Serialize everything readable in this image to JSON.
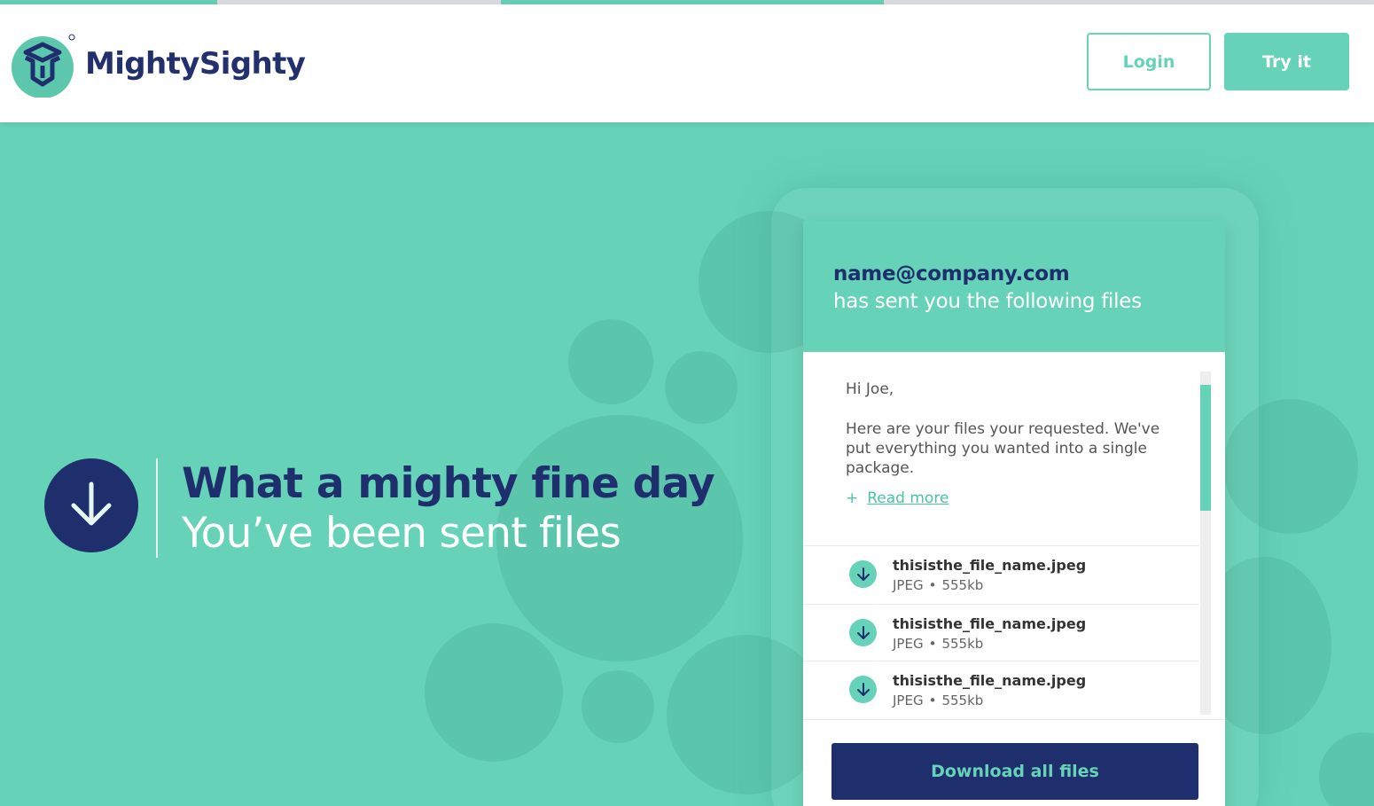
{
  "header": {
    "brand": "MightySighty",
    "login_label": "Login",
    "try_label": "Try it"
  },
  "hero": {
    "title": "What a mighty fine day",
    "subtitle": "You’ve been sent files"
  },
  "card": {
    "sender_email": "name@company.com",
    "sender_text": "has sent you the following files",
    "greeting": "Hi Joe,",
    "message": "Here are your files your requested. We've put everything you wanted into a single package.",
    "read_more_plus": "+",
    "read_more": "Read more",
    "files": [
      {
        "name": "thisisthe_file_name.jpeg",
        "type": "JPEG",
        "size": "555kb"
      },
      {
        "name": "thisisthe_file_name.jpeg",
        "type": "JPEG",
        "size": "555kb"
      },
      {
        "name": "thisisthe_file_name.jpeg",
        "type": "JPEG",
        "size": "555kb"
      }
    ],
    "download_all_label": "Download all files",
    "meta_separator": "•"
  },
  "colors": {
    "accent": "#66d2b8",
    "navy": "#1f2f6e",
    "background": "#66d2b8"
  },
  "icons": {
    "logo": "box-logo-icon",
    "hero": "download-arrow-icon",
    "file": "download-arrow-icon"
  }
}
